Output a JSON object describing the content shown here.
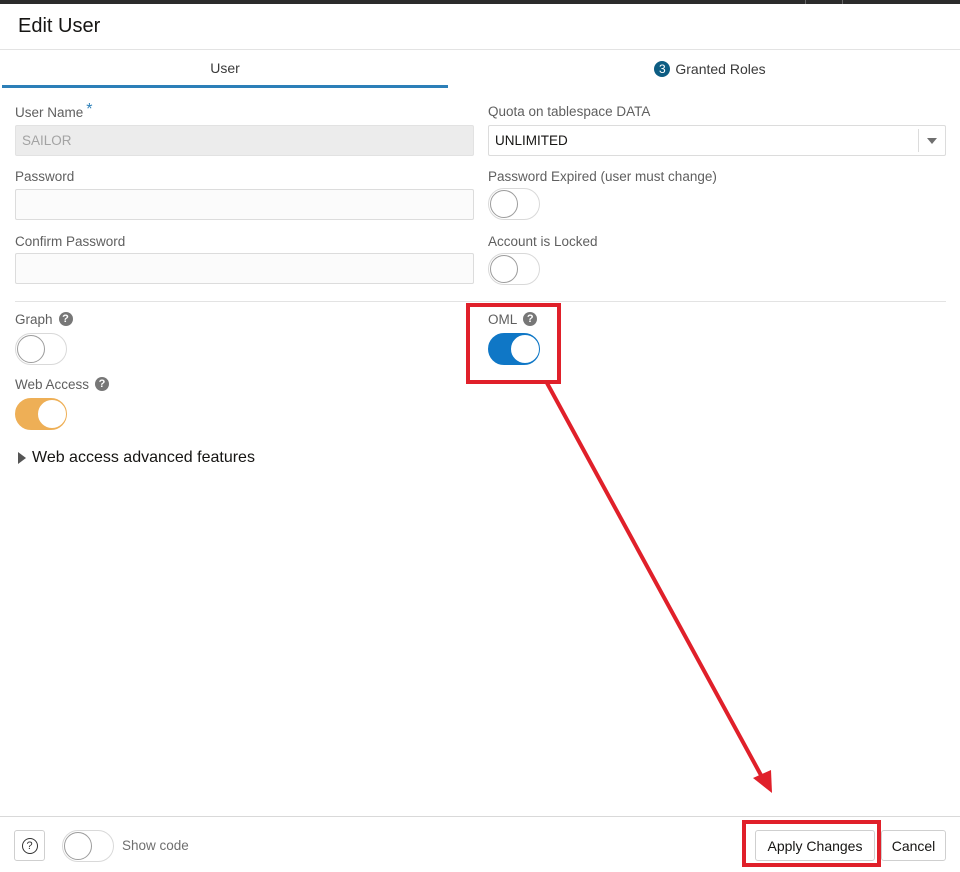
{
  "dialog": {
    "title": "Edit User"
  },
  "tabs": [
    {
      "label": "User",
      "selected": true
    },
    {
      "label": "Granted Roles",
      "badge": "3",
      "selected": false
    }
  ],
  "form": {
    "user_name": {
      "label": "User Name",
      "required_mark": "*",
      "value": "SAILOR"
    },
    "password": {
      "label": "Password",
      "value": ""
    },
    "confirm_password": {
      "label": "Confirm Password",
      "value": ""
    },
    "quota": {
      "label": "Quota on tablespace DATA",
      "value": "UNLIMITED"
    },
    "password_expired": {
      "label": "Password Expired (user must change)",
      "on": false
    },
    "account_locked": {
      "label": "Account is Locked",
      "on": false
    },
    "graph": {
      "label": "Graph",
      "help": "?",
      "on": false
    },
    "oml": {
      "label": "OML",
      "help": "?",
      "on": true
    },
    "web_access": {
      "label": "Web Access",
      "help": "?",
      "on": true
    },
    "advanced": {
      "label": "Web access advanced features"
    }
  },
  "footer": {
    "help_glyph": "?",
    "show_code_label": "Show code",
    "show_code_on": false,
    "apply_label": "Apply Changes",
    "cancel_label": "Cancel"
  },
  "colors": {
    "accent": "#2c7fb8",
    "toggle_on_blue": "#0f77c6",
    "toggle_on_orange": "#eeaf56",
    "annotation_red": "#e0202a"
  }
}
